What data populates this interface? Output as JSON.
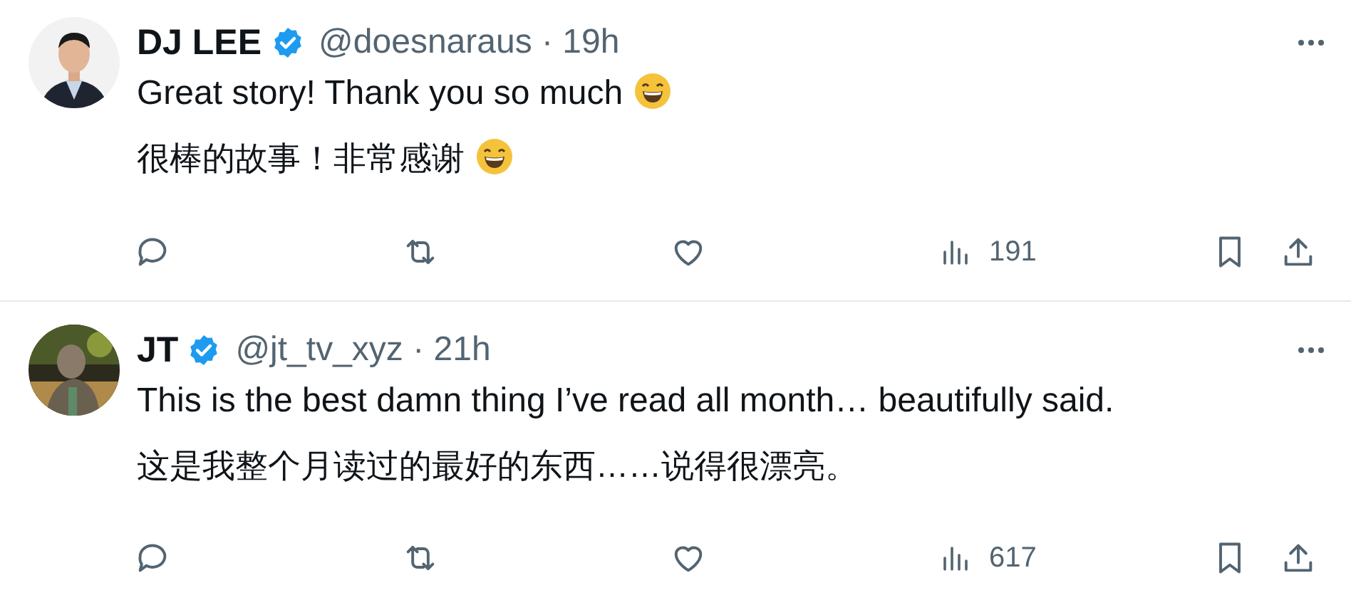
{
  "tweets": [
    {
      "name": "DJ LEE",
      "verified": true,
      "handle": "@doesnaraus",
      "separator": "·",
      "time": "19h",
      "paragraphs": [
        {
          "text": "Great story! Thank you so much",
          "trailing_emoji": true
        },
        {
          "text": "很棒的故事！非常感谢",
          "trailing_emoji": true
        }
      ],
      "views": "191"
    },
    {
      "name": "JT",
      "verified": true,
      "handle": "@jt_tv_xyz",
      "separator": "·",
      "time": "21h",
      "paragraphs": [
        {
          "text": "This is the best damn thing I’ve read all month… beautifully said.",
          "trailing_emoji": false
        },
        {
          "text": "这是我整个月读过的最好的东西……说得很漂亮。",
          "trailing_emoji": false
        }
      ],
      "views": "617"
    }
  ]
}
